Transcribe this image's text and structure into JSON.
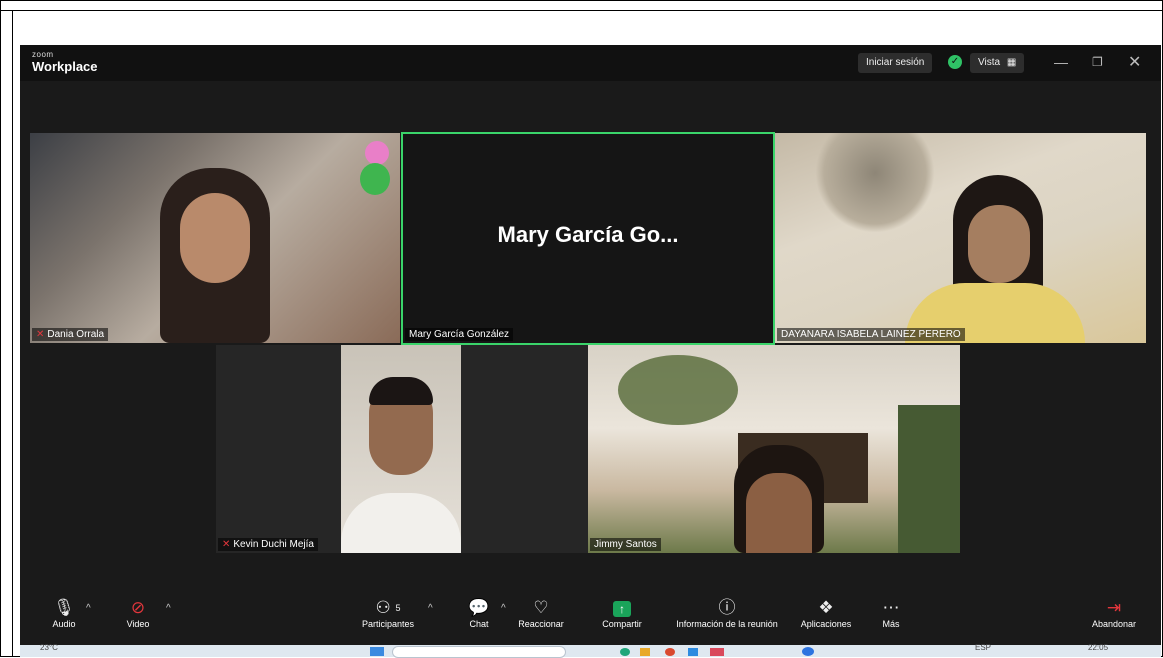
{
  "titlebar": {
    "logo_small": "zoom",
    "logo_big": "Workplace",
    "signin": "Iniciar sesión",
    "view": "Vista"
  },
  "participants": [
    {
      "name": "Dania Orrala",
      "muted": true
    },
    {
      "name": "Mary García González",
      "muted": false,
      "display_name": "Mary García Go...",
      "active": true
    },
    {
      "name": "DAYANARA ISABELA LAINEZ PERERO",
      "muted": false
    },
    {
      "name": "Kevin Duchi Mejía",
      "muted": true
    },
    {
      "name": "Jimmy Santos",
      "muted": false
    }
  ],
  "toolbar": {
    "audio": "Audio",
    "video": "Video",
    "participants": "Participantes",
    "participants_count": "5",
    "chat": "Chat",
    "react": "Reaccionar",
    "share": "Compartir",
    "info": "Información de la reunión",
    "apps": "Aplicaciones",
    "more": "Más",
    "leave": "Abandonar"
  },
  "taskbar": {
    "temp": "23°C",
    "lang": "ESP",
    "time": "22:05"
  },
  "colors": {
    "active_border": "#3ad46a",
    "muted": "#e2363c",
    "share_green": "#1aa45a",
    "leave_red": "#e2363c"
  }
}
